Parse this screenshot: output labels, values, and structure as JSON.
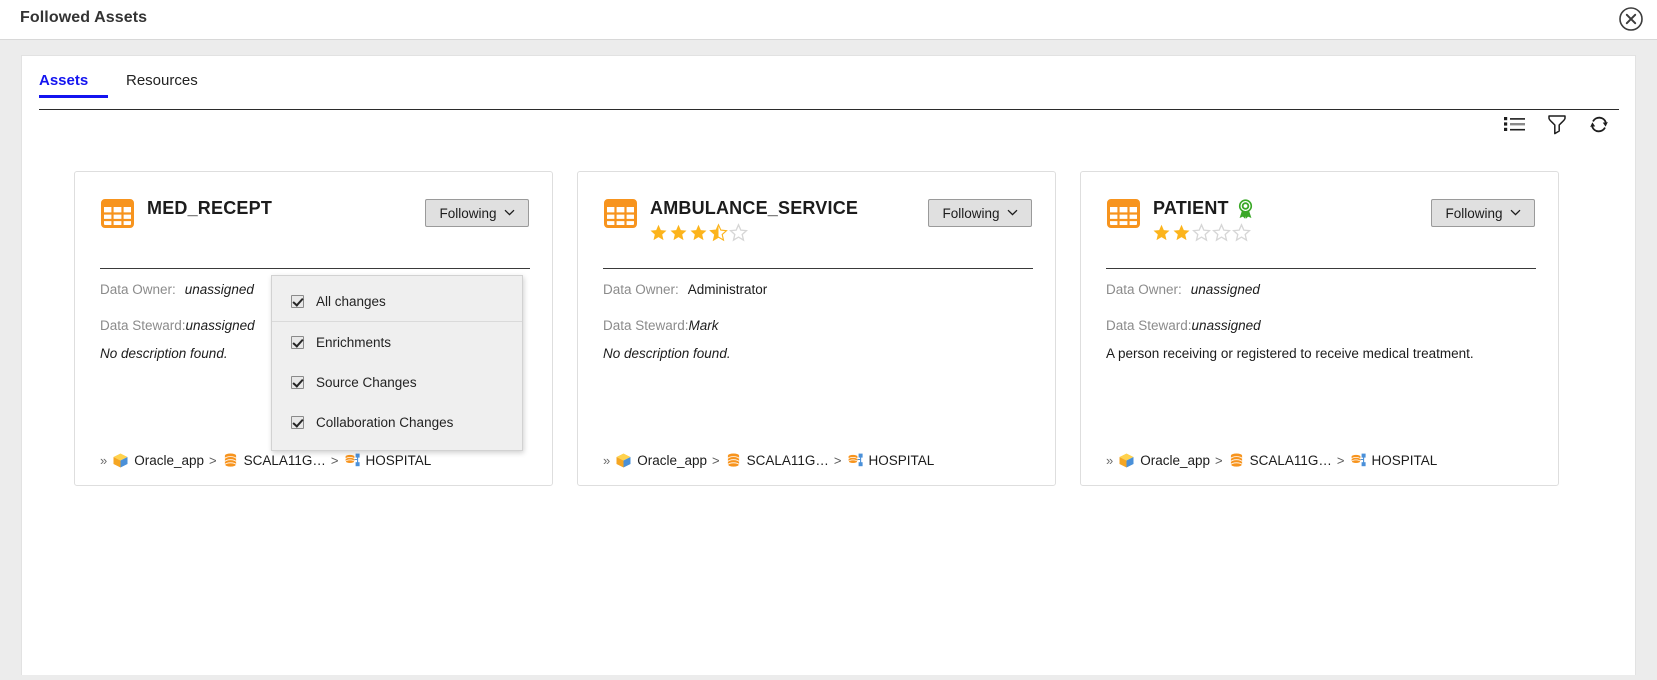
{
  "window": {
    "title": "Followed Assets",
    "close_icon": "close-circle-icon"
  },
  "tabs": [
    {
      "label": "Assets",
      "active": true
    },
    {
      "label": "Resources",
      "active": false
    }
  ],
  "toolbar": {
    "icons": [
      {
        "name": "list-view-icon",
        "label": "List view"
      },
      {
        "name": "filter-icon",
        "label": "Filter"
      },
      {
        "name": "refresh-icon",
        "label": "Refresh"
      }
    ]
  },
  "labels": {
    "data_owner": "Data Owner:",
    "data_steward": "Data Steward:",
    "follow_button": "Following",
    "caret": "⌄"
  },
  "colors": {
    "accent": "#1414f0",
    "table_icon": "#f7941e",
    "star_filled": "#fcb41c",
    "star_empty": "#d6d6d6",
    "certified": "#3aa827",
    "panel_bg": "#ffffff",
    "page_bg": "#ececec",
    "menu_bg": "#efefef",
    "button_bg": "#e0e0e0"
  },
  "cards": [
    {
      "title": "MED_RECEPT",
      "icon": "table-icon",
      "certified": false,
      "rating": 0,
      "rating_max": 5,
      "follow_label": "Following",
      "data_owner": "unassigned",
      "data_owner_italic": true,
      "data_steward": "unassigned",
      "data_steward_italic": true,
      "description": "No description found.",
      "description_italic": true,
      "breadcrumb": [
        {
          "label": "Oracle_app",
          "icon": "cube-icon"
        },
        {
          "label": "SCALA11G…",
          "icon": "database-icon"
        },
        {
          "label": "HOSPITAL",
          "icon": "schema-icon"
        }
      ]
    },
    {
      "title": "AMBULANCE_SERVICE",
      "icon": "table-icon",
      "certified": false,
      "rating": 3.5,
      "rating_max": 5,
      "follow_label": "Following",
      "data_owner": "Administrator",
      "data_owner_italic": false,
      "data_steward": "Mark",
      "data_steward_italic": true,
      "description": "No description found.",
      "description_italic": true,
      "breadcrumb": [
        {
          "label": "Oracle_app",
          "icon": "cube-icon"
        },
        {
          "label": "SCALA11G…",
          "icon": "database-icon"
        },
        {
          "label": "HOSPITAL",
          "icon": "schema-icon"
        }
      ]
    },
    {
      "title": "PATIENT",
      "icon": "table-icon",
      "certified": true,
      "rating": 2,
      "rating_max": 5,
      "follow_label": "Following",
      "data_owner": "unassigned",
      "data_owner_italic": true,
      "data_steward": "unassigned",
      "data_steward_italic": true,
      "description": "A person receiving or registered to receive medical treatment.",
      "description_italic": false,
      "breadcrumb": [
        {
          "label": "Oracle_app",
          "icon": "cube-icon"
        },
        {
          "label": "SCALA11G…",
          "icon": "database-icon"
        },
        {
          "label": "HOSPITAL",
          "icon": "schema-icon"
        }
      ]
    }
  ],
  "dropdown": {
    "open": true,
    "owner_card_index": 0,
    "items": [
      {
        "label": "All changes",
        "checked": true,
        "separator_after": true
      },
      {
        "label": "Enrichments",
        "checked": true,
        "separator_after": false
      },
      {
        "label": "Source Changes",
        "checked": true,
        "separator_after": false
      },
      {
        "label": "Collaboration Changes",
        "checked": true,
        "separator_after": false
      }
    ]
  }
}
